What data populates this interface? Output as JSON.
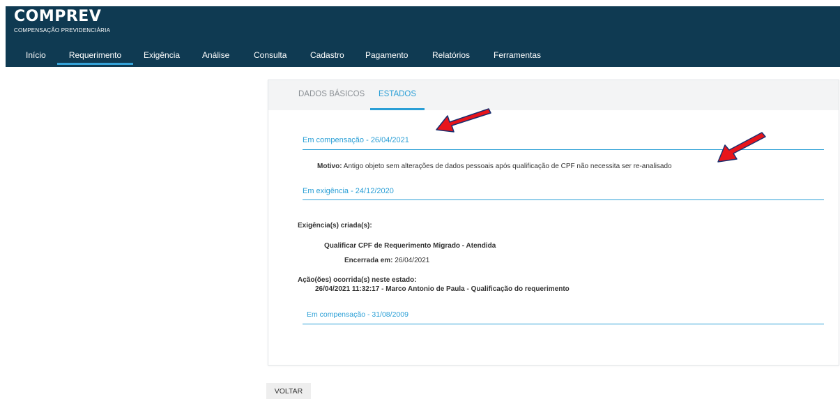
{
  "app": {
    "title": "COMPREV",
    "subtitle": "COMPENSAÇÃO PREVIDENCIÁRIA"
  },
  "nav": {
    "items": [
      {
        "label": "Início"
      },
      {
        "label": "Requerimento"
      },
      {
        "label": "Exigência"
      },
      {
        "label": "Análise"
      },
      {
        "label": "Consulta"
      },
      {
        "label": "Cadastro"
      },
      {
        "label": "Pagamento"
      },
      {
        "label": "Relatórios"
      },
      {
        "label": "Ferramentas"
      }
    ],
    "active": "Requerimento"
  },
  "tabs": {
    "items": [
      {
        "label": "DADOS BÁSICOS"
      },
      {
        "label": "ESTADOS"
      }
    ],
    "active": "ESTADOS"
  },
  "states": {
    "s1": {
      "heading": "Em compensação - 26/04/2021",
      "reason_label": "Motivo:",
      "reason_text": "Antigo objeto sem alterações de dados pessoais após qualificação de CPF não necessita ser re-analisado"
    },
    "s2": {
      "heading": "Em exigência - 24/12/2020",
      "created_label": "Exigência(s) criada(s):",
      "requirement": "Qualificar CPF de Requerimento Migrado - Atendida",
      "closed_label": "Encerrada em:",
      "closed_date": "26/04/2021",
      "actions_label": "Ação(ões) ocorrida(s) neste estado:",
      "action_entry": "26/04/2021 11:32:17 - Marco Antonio de Paula - Qualificação do requerimento"
    },
    "s3": {
      "heading": "Em compensação - 31/08/2009"
    }
  },
  "footer": {
    "back_label": "VOLTAR"
  },
  "colors": {
    "header_bg": "#0f3a52",
    "accent": "#2a9fd6",
    "annotation_arrow": "#e8151b"
  }
}
